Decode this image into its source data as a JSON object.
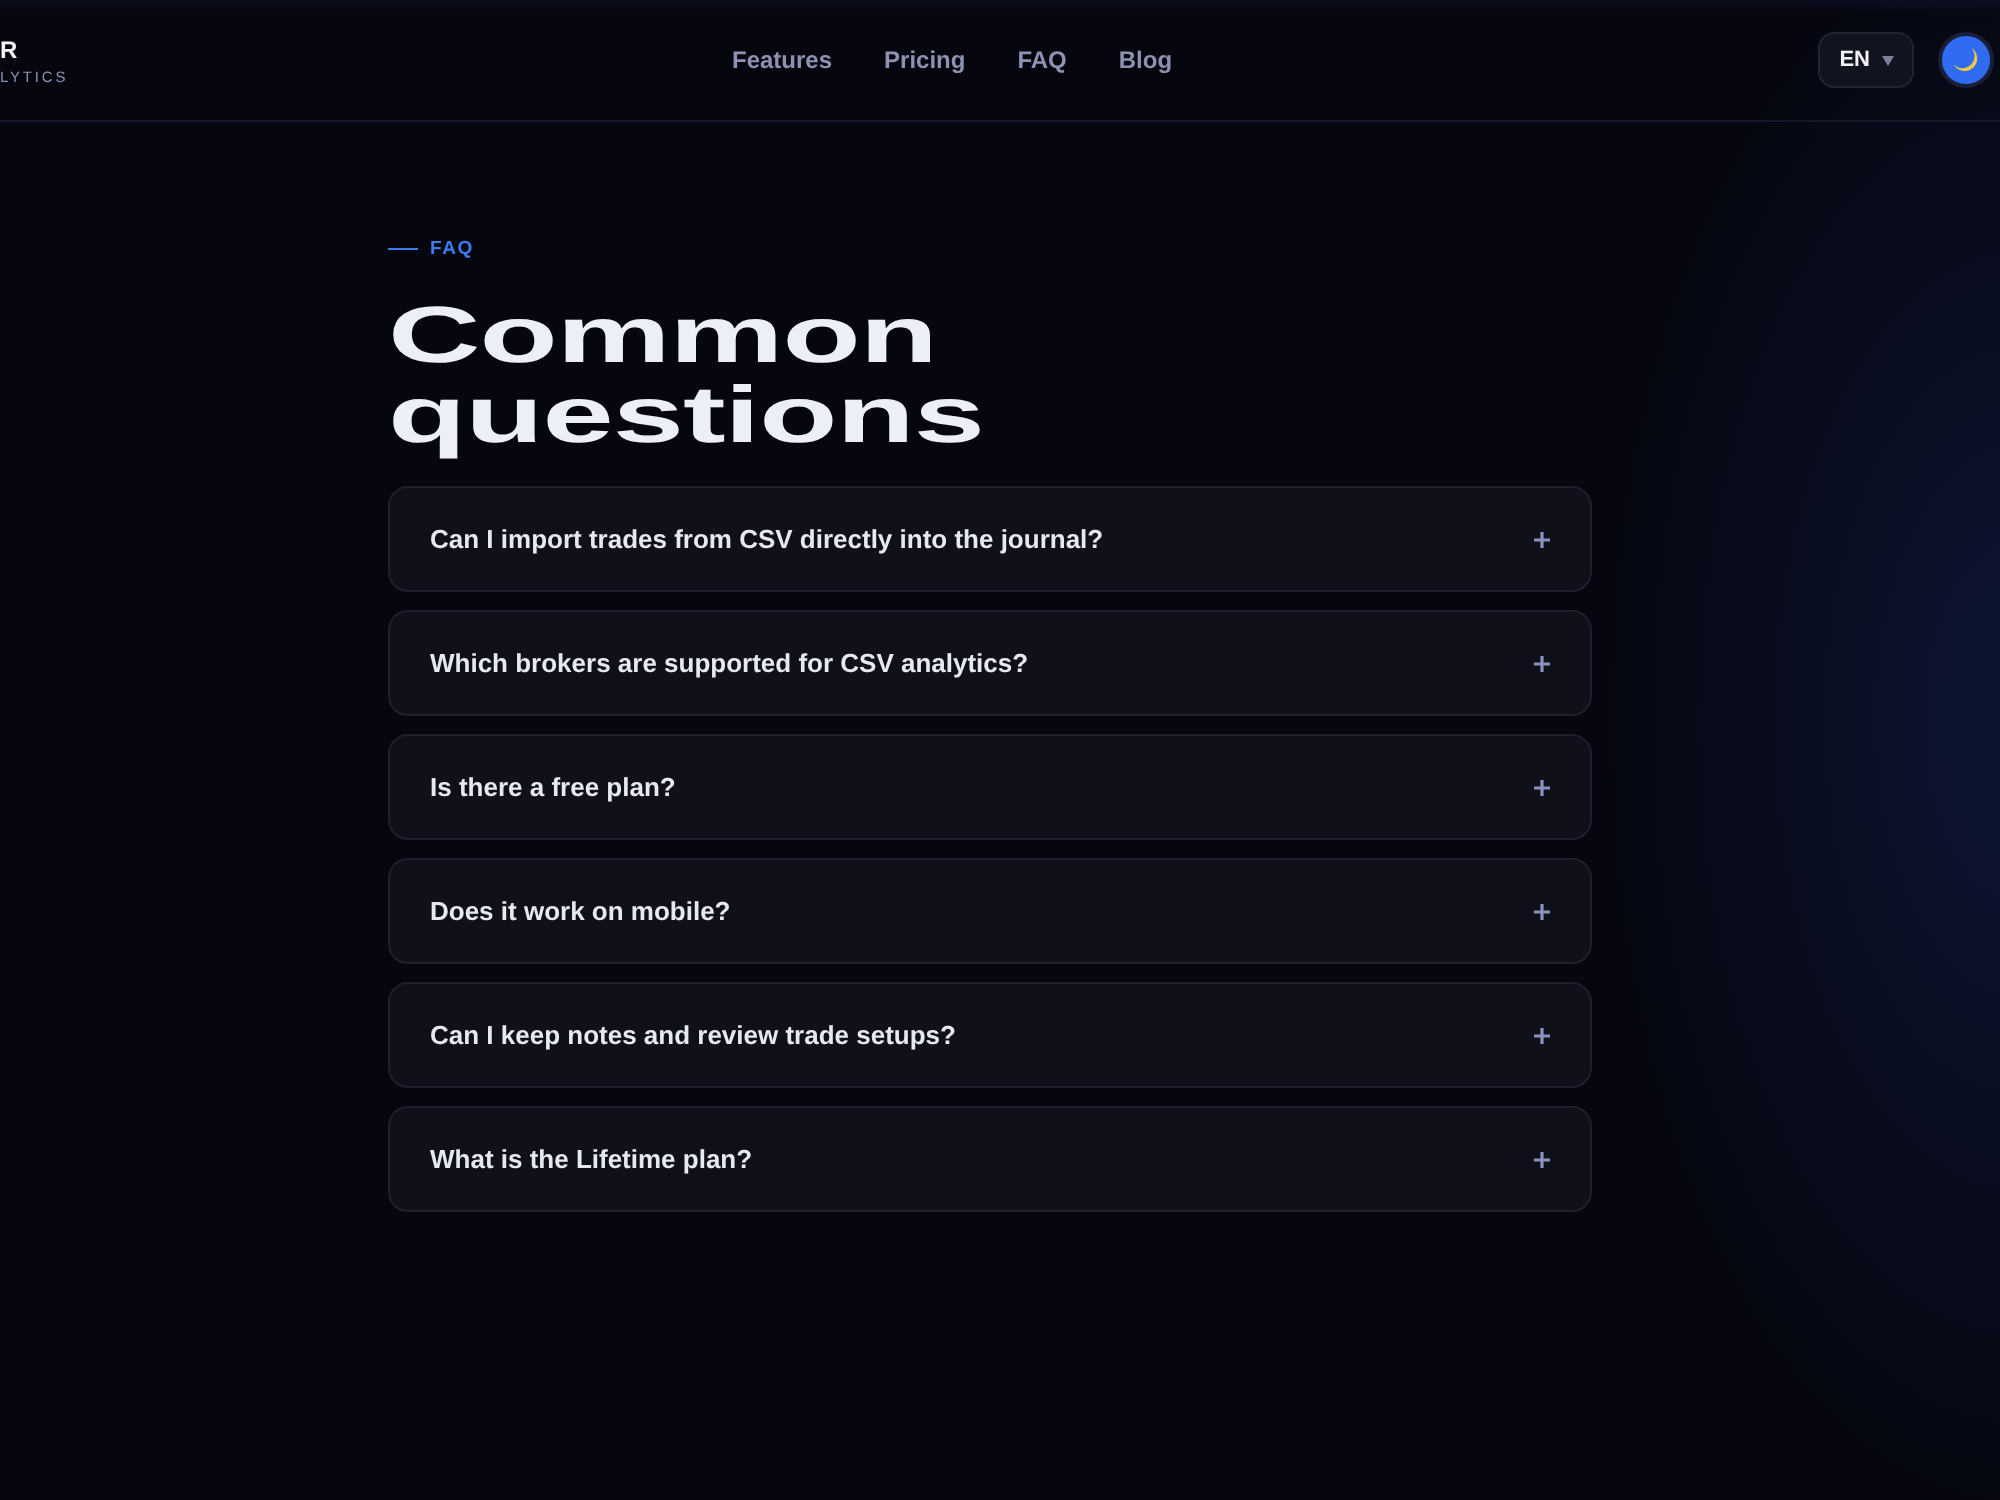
{
  "brand": {
    "name": "R",
    "tagline": "LYTICS"
  },
  "nav": {
    "links": [
      {
        "label": "Features"
      },
      {
        "label": "Pricing"
      },
      {
        "label": "FAQ"
      },
      {
        "label": "Blog"
      }
    ]
  },
  "language": {
    "label": "EN"
  },
  "faq": {
    "eyebrow": "FAQ",
    "title": "Common questions",
    "items": [
      {
        "question": "Can I import trades from CSV directly into the journal?",
        "expanded": false
      },
      {
        "question": "Which brokers are supported for CSV analytics?",
        "expanded": false
      },
      {
        "question": "Is there a free plan?",
        "expanded": false
      },
      {
        "question": "Does it work on mobile?",
        "expanded": false
      },
      {
        "question": "Can I keep notes and review trade setups?",
        "expanded": false
      },
      {
        "question": "What is the Lifetime plan?",
        "expanded": false
      }
    ]
  }
}
